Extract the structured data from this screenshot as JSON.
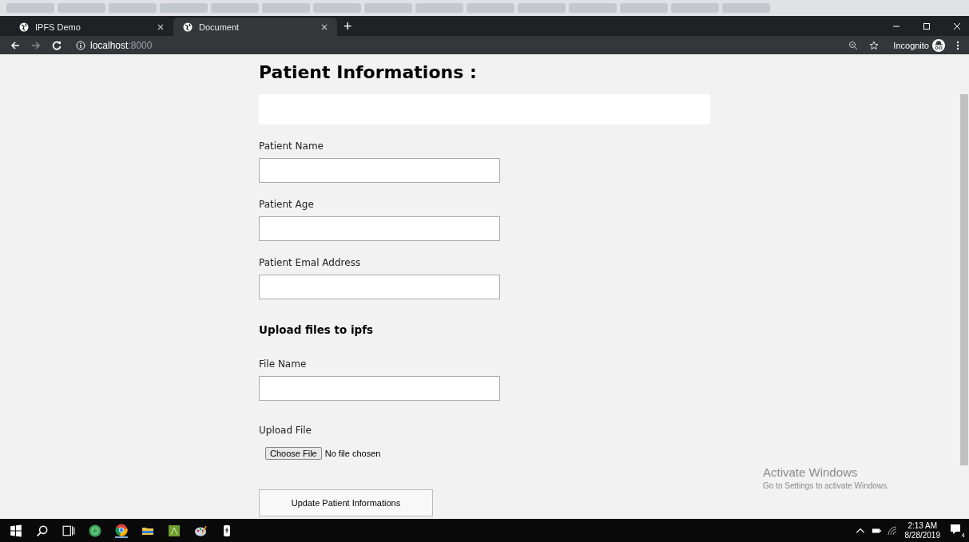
{
  "browser": {
    "tabs": [
      {
        "title": "IPFS Demo",
        "selected": false
      },
      {
        "title": "Document",
        "selected": true
      }
    ],
    "new_tab": "+",
    "address": {
      "host": "localhost",
      "port": ":8000"
    },
    "incognito": "Incognito"
  },
  "form": {
    "title": "Patient Informations :",
    "fields": [
      {
        "label": "Patient Name"
      },
      {
        "label": "Patient Age"
      },
      {
        "label": "Patient Emal Address"
      }
    ],
    "upload_heading": "Upload files to ipfs",
    "file_name_label": "File Name",
    "upload_label": "Upload File",
    "choose_button": "Choose File",
    "file_status": "No file chosen",
    "submit": "Update Patient Informations"
  },
  "activation": {
    "title": "Activate Windows",
    "subtitle": "Go to Settings to activate Windows."
  },
  "taskbar": {
    "time": "2:13 AM",
    "date": "8/28/2019",
    "notifications": "4"
  }
}
